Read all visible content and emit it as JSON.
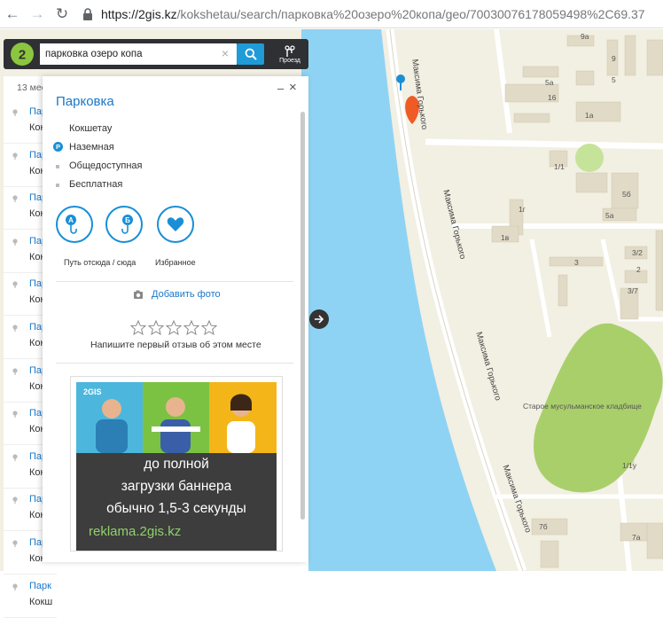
{
  "browser": {
    "url_host": "https://2gis.kz",
    "url_path": "/kokshetau/search/парковка%20озеро%20копа/geo/70030076178059498%2C69.37"
  },
  "search": {
    "value": "парковка озеро копа",
    "route_label": "Проезд"
  },
  "results": {
    "count_label": "13 мес",
    "items": [
      {
        "title": "Парк",
        "city": "Кокш"
      },
      {
        "title": "Парк",
        "city": "Кокш"
      },
      {
        "title": "Парк",
        "city": "Кокш"
      },
      {
        "title": "Парк",
        "city": "Кокш"
      },
      {
        "title": "Парк",
        "city": "Кокш"
      },
      {
        "title": "Парк",
        "city": "Кокш"
      },
      {
        "title": "Парк",
        "city": "Кокш"
      },
      {
        "title": "Парк",
        "city": "Кокш"
      },
      {
        "title": "Парк",
        "city": "Кокш"
      },
      {
        "title": "Парк",
        "city": "Кокш"
      },
      {
        "title": "Парк",
        "city": "Кокш"
      },
      {
        "title": "Парк",
        "city": "Кокш"
      }
    ]
  },
  "card": {
    "title": "Парковка",
    "attributes": [
      "Кокшетау",
      "Наземная",
      "Общедоступная",
      "Бесплатная"
    ],
    "parking_badge": "P",
    "actions": {
      "route_label": "Путь отсюда / сюда",
      "favorite_label": "Избранное",
      "badge_a": "А",
      "badge_b": "Б"
    },
    "add_photo": "Добавить фото",
    "review_hint": "Напишите первый отзыв об этом месте",
    "minimize": "–",
    "close": "×"
  },
  "banner": {
    "logo": "2GIS",
    "line1": "до полной",
    "line2": "загрузки баннера",
    "line3": "обычно 1,5-3 секунды",
    "link": "reklama.2gis.kz"
  },
  "map": {
    "street": "Максима Горького",
    "cemetery": "Старое мусульманское кладбище",
    "buildings": [
      "9а",
      "9",
      "5а",
      "5",
      "16",
      "1а",
      "1/1",
      "5б",
      "1г",
      "5а",
      "1в",
      "3/2",
      "3",
      "2",
      "3/7",
      "1/1у",
      "7б",
      "7а"
    ]
  },
  "colors": {
    "water": "#8fd3f4",
    "land": "#f2efe3",
    "accent": "#1a8fd6",
    "park": "#a9cf6b"
  }
}
